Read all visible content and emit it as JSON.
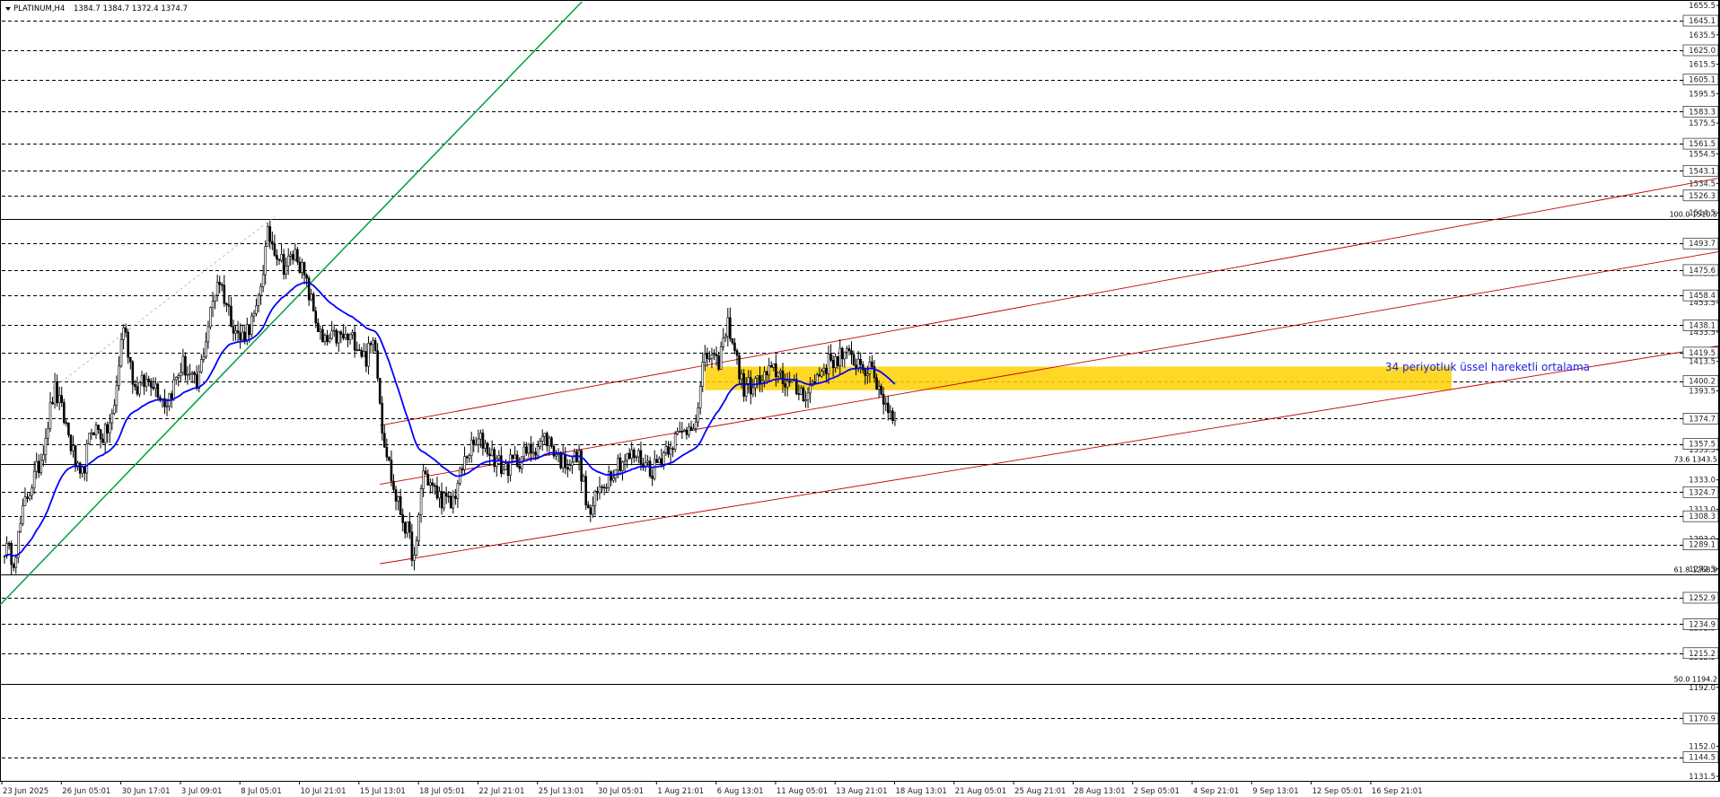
{
  "header": {
    "symbol_label": "PLATINUM,H4",
    "ohlc": "1384.7 1384.7 1372.4 1374.7"
  },
  "colors": {
    "background": "#ffffff",
    "grid": "#000000",
    "candle": "#000000",
    "ema": "#0000ff",
    "trendline_green": "#00a03c",
    "channel_red": "#c00000",
    "zone": "#ffd000",
    "fib_line": "#000000"
  },
  "chart_data": {
    "type": "candlestick",
    "ylim": [
      1131.5,
      1665.5
    ],
    "price_axis_ticks": [
      "1655.5",
      "1635.5",
      "1615.5",
      "1595.5",
      "1575.5",
      "1554.5",
      "1534.5",
      "1514.5",
      "1493.5",
      "1473.5",
      "1453.5",
      "1433.5",
      "1413.5",
      "1393.5",
      "1373.5",
      "1353.5",
      "1333.0",
      "1313.0",
      "1293.0",
      "1272.5",
      "1252.5",
      "1232.5",
      "1212.5",
      "1192.0",
      "1172.0",
      "1152.0",
      "1131.5"
    ],
    "level_labels": [
      "1645.1",
      "1625.0",
      "1605.1",
      "1583.3",
      "1561.5",
      "1543.1",
      "1526.3",
      "1493.7",
      "1475.6",
      "1458.4",
      "1438.1",
      "1419.5",
      "1400.2",
      "1374.7",
      "1357.5",
      "1324.7",
      "1308.3",
      "1289.1",
      "1252.9",
      "1234.9",
      "1215.2",
      "1170.9",
      "1144.5"
    ],
    "level_values": [
      1645.1,
      1625.0,
      1605.1,
      1583.3,
      1561.5,
      1543.1,
      1526.3,
      1493.7,
      1475.6,
      1458.4,
      1438.1,
      1419.5,
      1400.2,
      1374.7,
      1357.5,
      1324.7,
      1308.3,
      1289.1,
      1252.9,
      1234.9,
      1215.2,
      1170.9,
      1144.5
    ],
    "x_labels": [
      "23 Jun 2025",
      "26 Jun 05:01",
      "30 Jun 17:01",
      "3 Jul 09:01",
      "8 Jul 05:01",
      "10 Jul 21:01",
      "15 Jul 13:01",
      "18 Jul 05:01",
      "22 Jul 21:01",
      "25 Jul 13:01",
      "30 Jul 05:01",
      "1 Aug 21:01",
      "6 Aug 13:01",
      "11 Aug 05:01",
      "13 Aug 21:01",
      "18 Aug 13:01",
      "21 Aug 05:01",
      "25 Aug 21:01",
      "28 Aug 13:01",
      "2 Sep 05:01",
      "4 Sep 21:01",
      "9 Sep 13:01",
      "12 Sep 05:01",
      "16 Sep 21:01"
    ],
    "fibonacci": [
      {
        "label": "100.0 1510.5",
        "value": 1510.5
      },
      {
        "label": "73.6 1343.5",
        "value": 1343.5
      },
      {
        "label": "61.8 1268.9",
        "value": 1268.9
      },
      {
        "label": "50.0 1194.2",
        "value": 1194.2
      }
    ],
    "last_price": 1374.7,
    "ema_label": "34 periyotluk üssel hareketli ortalama",
    "candle_count": 390,
    "close_anchors": [
      [
        0,
        1287
      ],
      [
        8,
        1280
      ],
      [
        18,
        1320
      ],
      [
        30,
        1345
      ],
      [
        42,
        1395
      ],
      [
        52,
        1370
      ],
      [
        64,
        1330
      ],
      [
        74,
        1370
      ],
      [
        84,
        1362
      ],
      [
        92,
        1378
      ],
      [
        100,
        1440
      ],
      [
        110,
        1395
      ],
      [
        124,
        1402
      ],
      [
        136,
        1385
      ],
      [
        150,
        1412
      ],
      [
        162,
        1395
      ],
      [
        172,
        1440
      ],
      [
        180,
        1472
      ],
      [
        188,
        1450
      ],
      [
        198,
        1428
      ],
      [
        212,
        1445
      ],
      [
        222,
        1500
      ],
      [
        236,
        1478
      ],
      [
        246,
        1488
      ],
      [
        258,
        1455
      ],
      [
        268,
        1425
      ],
      [
        280,
        1430
      ],
      [
        296,
        1428
      ],
      [
        304,
        1415
      ],
      [
        312,
        1430
      ],
      [
        318,
        1370
      ],
      [
        328,
        1325
      ],
      [
        340,
        1296
      ],
      [
        346,
        1275
      ],
      [
        352,
        1340
      ],
      [
        362,
        1325
      ],
      [
        376,
        1315
      ],
      [
        390,
        1352
      ],
      [
        402,
        1360
      ],
      [
        420,
        1340
      ],
      [
        438,
        1350
      ],
      [
        456,
        1362
      ],
      [
        470,
        1345
      ],
      [
        484,
        1348
      ],
      [
        492,
        1308
      ],
      [
        502,
        1328
      ],
      [
        516,
        1345
      ],
      [
        532,
        1350
      ],
      [
        546,
        1340
      ],
      [
        560,
        1358
      ],
      [
        572,
        1365
      ],
      [
        584,
        1378
      ],
      [
        590,
        1420
      ],
      [
        600,
        1410
      ],
      [
        610,
        1440
      ],
      [
        622,
        1395
      ],
      [
        636,
        1400
      ],
      [
        650,
        1408
      ],
      [
        664,
        1395
      ],
      [
        676,
        1392
      ],
      [
        690,
        1410
      ],
      [
        704,
        1418
      ],
      [
        720,
        1413
      ],
      [
        732,
        1404
      ],
      [
        745,
        1380
      ],
      [
        750,
        1375
      ]
    ],
    "ema_path_in_candles": "computed-from-closes",
    "timeframe": "H4"
  }
}
